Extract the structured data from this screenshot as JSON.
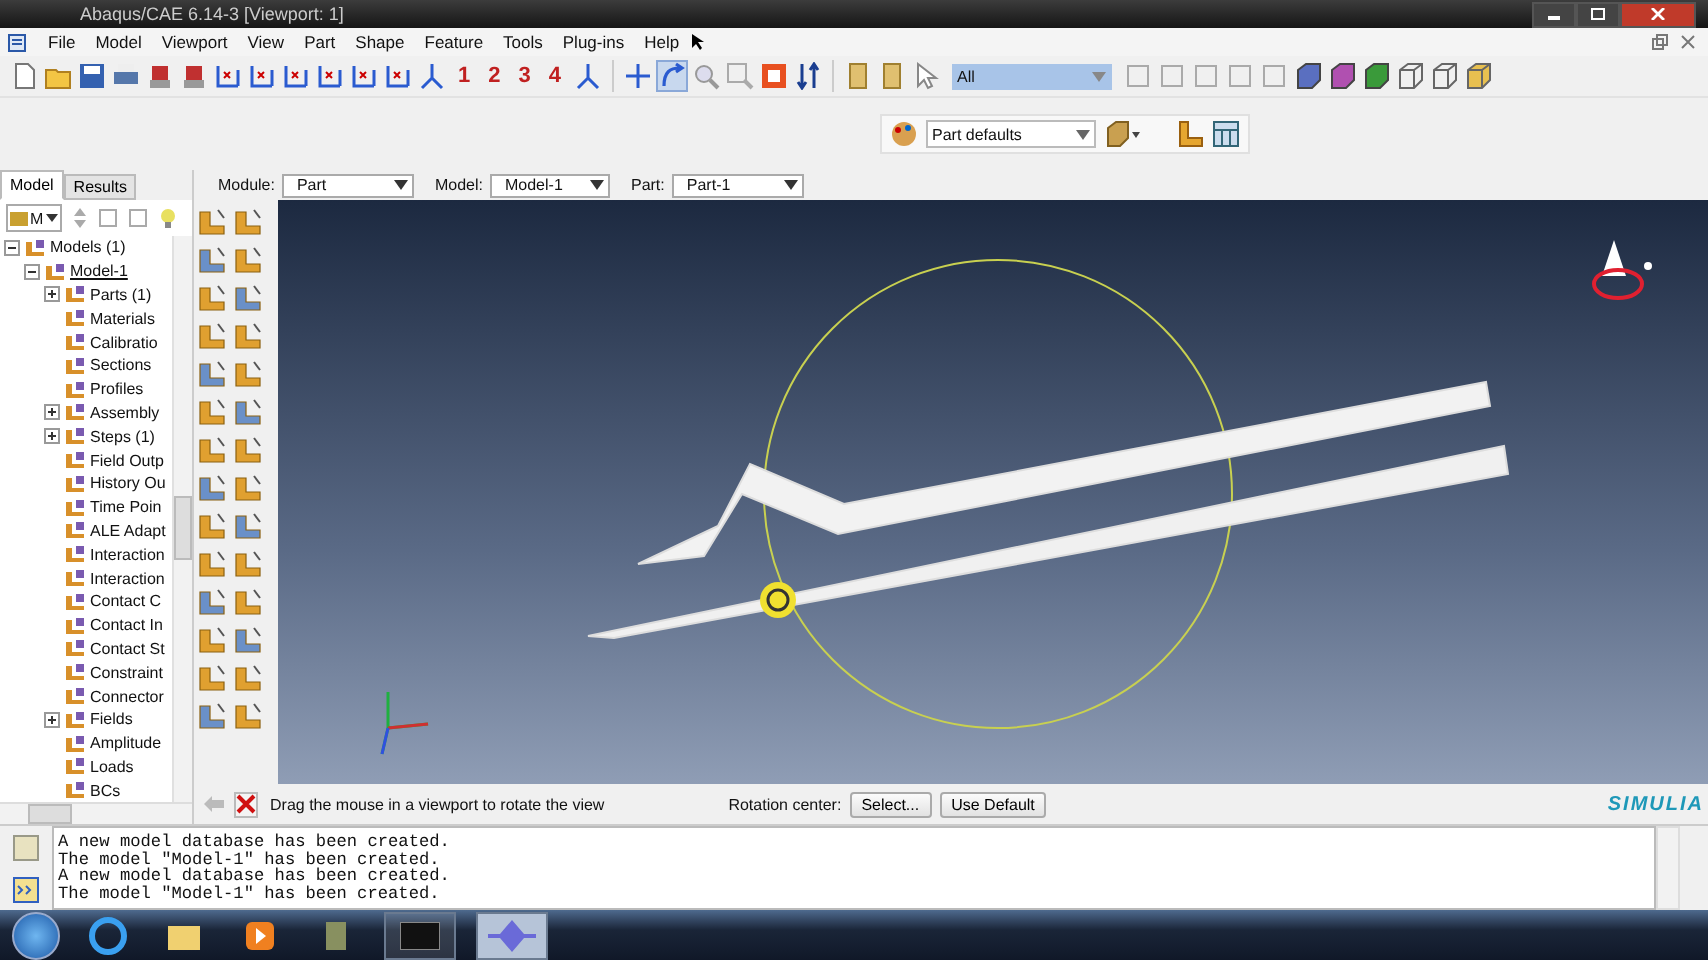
{
  "window": {
    "title": "Abaqus/CAE 6.14-3 [Viewport: 1]"
  },
  "menu": [
    "File",
    "Model",
    "Viewport",
    "View",
    "Part",
    "Shape",
    "Feature",
    "Tools",
    "Plug-ins",
    "Help"
  ],
  "toolbar": {
    "view_numbers": [
      "1",
      "2",
      "3",
      "4"
    ],
    "selection_filter": "All",
    "render_style": "Part defaults"
  },
  "tabs": [
    {
      "label": "Model",
      "selected": true
    },
    {
      "label": "Results",
      "selected": false
    }
  ],
  "tree_filter": "M",
  "context": [
    {
      "label": "Module:",
      "value": "Part"
    },
    {
      "label": "Model:",
      "value": "Model-1"
    },
    {
      "label": "Part:",
      "value": "Part-1"
    }
  ],
  "tree": [
    {
      "label": "Models (1)",
      "kind": "branch",
      "expanded": true,
      "children": [
        {
          "label": "Model-1",
          "kind": "branch",
          "expanded": true,
          "children": [
            {
              "label": "Parts (1)",
              "kind": "branch",
              "expanded": false
            },
            {
              "label": "Materials",
              "kind": "leaf"
            },
            {
              "label": "Calibratio",
              "kind": "leaf"
            },
            {
              "label": "Sections",
              "kind": "leaf"
            },
            {
              "label": "Profiles",
              "kind": "leaf"
            },
            {
              "label": "Assembly",
              "kind": "branch",
              "expanded": false
            },
            {
              "label": "Steps (1)",
              "kind": "branch",
              "expanded": false
            },
            {
              "label": "Field Outp",
              "kind": "leaf"
            },
            {
              "label": "History Ou",
              "kind": "leaf"
            },
            {
              "label": "Time Poin",
              "kind": "leaf"
            },
            {
              "label": "ALE Adapt",
              "kind": "leaf"
            },
            {
              "label": "Interaction",
              "kind": "leaf"
            },
            {
              "label": "Interaction",
              "kind": "leaf"
            },
            {
              "label": "Contact C",
              "kind": "leaf"
            },
            {
              "label": "Contact In",
              "kind": "leaf"
            },
            {
              "label": "Contact St",
              "kind": "leaf"
            },
            {
              "label": "Constraint",
              "kind": "leaf"
            },
            {
              "label": "Connector",
              "kind": "leaf"
            },
            {
              "label": "Fields",
              "kind": "branch",
              "expanded": false
            },
            {
              "label": "Amplitude",
              "kind": "leaf"
            },
            {
              "label": "Loads",
              "kind": "leaf"
            },
            {
              "label": "BCs",
              "kind": "leaf"
            }
          ]
        }
      ]
    }
  ],
  "prompt": {
    "text": "Drag the mouse in a viewport to rotate the view",
    "rotation_label": "Rotation center:",
    "buttons": [
      "Select...",
      "Use Default"
    ]
  },
  "brand": "SIMULIA",
  "messages": [
    "A new model database has been created.",
    "The model \"Model-1\" has been created.",
    "A new model database has been created.",
    "The model \"Model-1\" has been created."
  ]
}
